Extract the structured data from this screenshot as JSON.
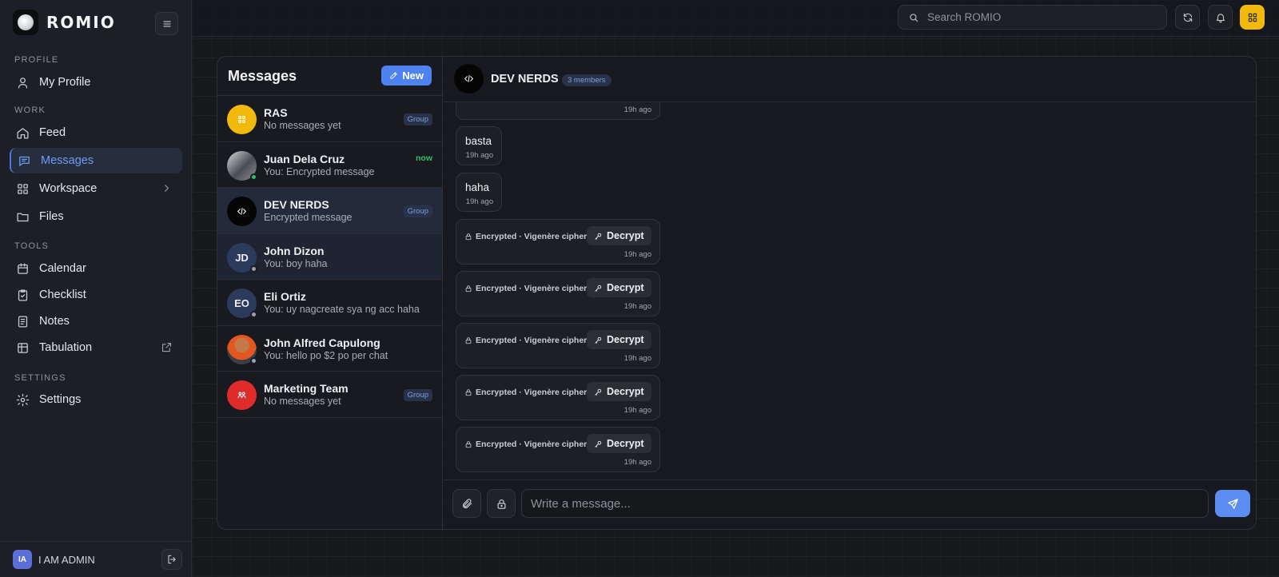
{
  "brand": {
    "name": "ROMIO"
  },
  "sidebar": {
    "sections": {
      "profile": "PROFILE",
      "work": "WORK",
      "tools": "TOOLS",
      "settings": "SETTINGS"
    },
    "items": {
      "my_profile": "My Profile",
      "feed": "Feed",
      "messages": "Messages",
      "workspace": "Workspace",
      "files": "Files",
      "calendar": "Calendar",
      "checklist": "Checklist",
      "notes": "Notes",
      "tabulation": "Tabulation",
      "settings": "Settings"
    },
    "active": "Messages",
    "user": {
      "initials": "IA",
      "name": "I AM ADMIN"
    }
  },
  "topbar": {
    "search_placeholder": "Search ROMIO"
  },
  "messages_panel": {
    "title": "Messages",
    "new_label": "New",
    "conversations": [
      {
        "name": "RAS",
        "preview": "No messages yet",
        "badge": "Group",
        "avatar": "grid-icon",
        "avatar_color": "#f0b90b"
      },
      {
        "name": "Juan Dela Cruz",
        "preview": "You: Encrypted message",
        "time": "now",
        "status": "online",
        "status_color": "#2fbf6d"
      },
      {
        "name": "DEV NERDS",
        "preview": "Encrypted message",
        "badge": "Group",
        "avatar": "code-icon",
        "avatar_color": "#050505",
        "active": true
      },
      {
        "name": "John Dizon",
        "initials": "JD",
        "preview": "You: boy haha",
        "avatar_color": "#2c3a5c",
        "status": "offline",
        "status_color": "#9aa0a9"
      },
      {
        "name": "Eli Ortiz",
        "initials": "EO",
        "preview": "You: uy nagcreate sya ng acc haha",
        "avatar_color": "#2c3a5c",
        "status": "offline",
        "status_color": "#9aa0a9"
      },
      {
        "name": "John Alfred Capulong",
        "preview": "You: hello po $2 po per chat",
        "status": "offline",
        "status_color": "#9aa0a9"
      },
      {
        "name": "Marketing Team",
        "preview": "No messages yet",
        "badge": "Group",
        "avatar": "users-icon",
        "avatar_color": "#e02b2b"
      }
    ]
  },
  "chat": {
    "title": "DEV NERDS",
    "members": "3 members",
    "messages": [
      {
        "type": "text",
        "text": "",
        "time": "19h ago"
      },
      {
        "type": "text",
        "text": "basta",
        "time": "19h ago"
      },
      {
        "type": "text",
        "text": "haha",
        "time": "19h ago"
      },
      {
        "type": "encrypted",
        "label": "Encrypted · Vigenère cipher",
        "action": "Decrypt",
        "time": "19h ago"
      },
      {
        "type": "encrypted",
        "label": "Encrypted · Vigenère cipher",
        "action": "Decrypt",
        "time": "19h ago"
      },
      {
        "type": "encrypted",
        "label": "Encrypted · Vigenère cipher",
        "action": "Decrypt",
        "time": "19h ago"
      },
      {
        "type": "encrypted",
        "label": "Encrypted · Vigenère cipher",
        "action": "Decrypt",
        "time": "19h ago"
      },
      {
        "type": "encrypted",
        "label": "Encrypted · Vigenère cipher",
        "action": "Decrypt",
        "time": "19h ago"
      }
    ],
    "composer_placeholder": "Write a message..."
  },
  "colors": {
    "accent": "#4d82f0",
    "brand_yellow": "#f0b90b",
    "online": "#2fbf6d"
  }
}
